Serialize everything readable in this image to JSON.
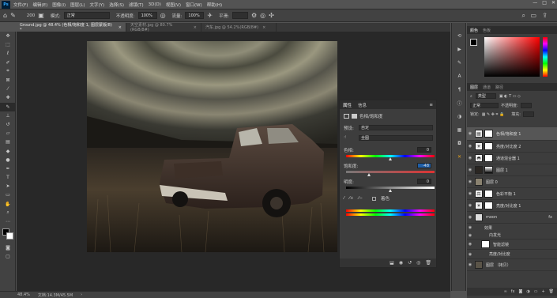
{
  "menubar": {
    "logo": "Ps",
    "items": [
      "文件(F)",
      "编辑(E)",
      "图像(I)",
      "图层(L)",
      "文字(Y)",
      "选择(S)",
      "滤镜(T)",
      "3D(D)",
      "视图(V)",
      "窗口(W)",
      "帮助(H)"
    ],
    "window_controls": [
      "—",
      "□",
      "✕"
    ]
  },
  "options": {
    "brush_size": "200",
    "mode_label": "模式:",
    "mode_value": "正常",
    "opacity_label": "不透明度:",
    "opacity_value": "100%",
    "flow_label": "流量:",
    "flow_value": "100%",
    "smooth_label": "平滑:"
  },
  "tabs": [
    {
      "label": "Ground.jpg @ 48.4% (色相/饱和度 1, 图层蒙版/8) *",
      "close": "×"
    },
    {
      "label": "天空素材.jpg @ 80.7%(RGB/8#)",
      "close": "×"
    },
    {
      "label": "汽车.jpg @ 54.2%(RGB/8#)",
      "close": "×"
    }
  ],
  "properties": {
    "tab_properties": "属性",
    "tab_info": "信息",
    "adjustment_title": "色相/饱和度",
    "preset_label": "预设:",
    "preset_value": "自定",
    "channel_value": "全图",
    "hue_label": "色相:",
    "hue_value": "0",
    "saturation_label": "饱和度:",
    "saturation_value": "-48",
    "lightness_label": "明度:",
    "lightness_value": "0",
    "colorize_label": "着色",
    "hue_level": 0.5,
    "saturation_level": 0.26,
    "lightness_level": 0.5
  },
  "color_panel": {
    "tab_color": "颜色",
    "tab_swatches": "色板"
  },
  "layers_panel": {
    "tab_layers": "图层",
    "tab_channels": "通道",
    "tab_paths": "路径",
    "kind_label": "类型",
    "blend_mode": "正常",
    "opacity_label": "不透明度:",
    "lock_label": "锁定:",
    "fill_label": "填充:",
    "layers": [
      {
        "name": "色相/饱和度 1",
        "selected": true
      },
      {
        "name": "亮度/对比度 2",
        "selected": false
      },
      {
        "name": "通道混合器 1",
        "selected": false
      },
      {
        "name": "图层 1",
        "selected": false
      },
      {
        "name": "图层 0",
        "selected": false
      },
      {
        "name": "色彩平衡 1",
        "selected": false
      },
      {
        "name": "亮度/对比度 1",
        "selected": false
      },
      {
        "name": "moon",
        "selected": false
      },
      {
        "name": "效果",
        "selected": false
      },
      {
        "name": "内发光",
        "selected": false
      },
      {
        "name": "智能滤镜",
        "selected": false
      },
      {
        "name": "亮度/对比度",
        "selected": false
      },
      {
        "name": "图层 （拷贝）",
        "selected": false
      }
    ],
    "moon_fx": "fx"
  },
  "status": {
    "zoom": "48.4%",
    "doc": "文档:14.3M/45.5M"
  }
}
